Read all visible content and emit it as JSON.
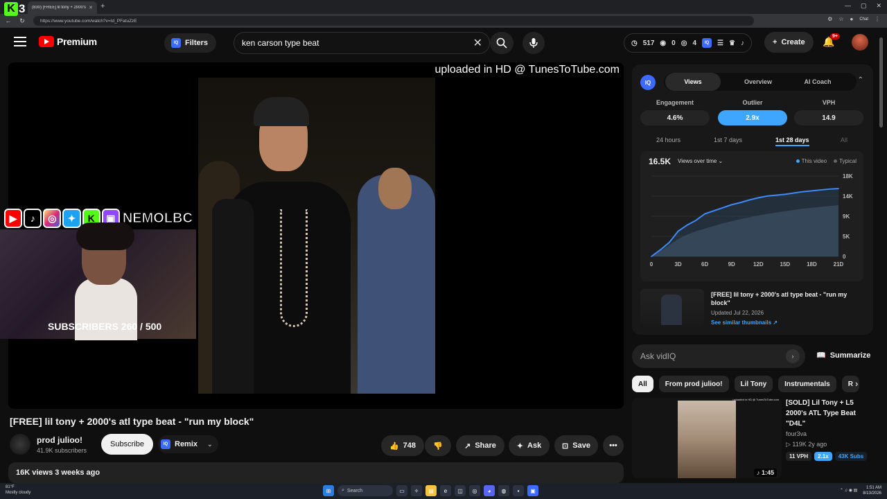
{
  "browser": {
    "tab_title": "(830) [FREE] lil tony + 2000's ...",
    "url": "https://www.youtube.com/watch?v=Id_PFatuZzE",
    "chat_label": "Chat",
    "kick_number": "3"
  },
  "header": {
    "brand": "Premium",
    "filters_label": "Filters",
    "search_value": "ken carson type beat",
    "stats": {
      "a": "517",
      "b": "0",
      "c": "4"
    },
    "create_label": "Create",
    "notif_badge": "9+"
  },
  "player": {
    "overlay_text": "uploaded in HD @ TunesToTube.com",
    "stream_handle": "NEMOLBC",
    "subscribers_goal": "SUBSCRIBERS 260 / 500"
  },
  "video": {
    "title": "[FREE] lil tony + 2000's atl type beat - \"run my block\"",
    "channel": "prod julioo!",
    "channel_subs": "41.9K subscribers",
    "subscribe_label": "Subscribe",
    "remix_label": "Remix",
    "likes": "748",
    "share_label": "Share",
    "ask_label": "Ask",
    "save_label": "Save",
    "views_line": "16K views  3 weeks ago"
  },
  "vidiq": {
    "tabs": [
      "Views",
      "Overview",
      "AI Coach"
    ],
    "metrics": [
      {
        "label": "Engagement",
        "value": "4.6%"
      },
      {
        "label": "Outlier",
        "value": "2.9x"
      },
      {
        "label": "VPH",
        "value": "14.9"
      }
    ],
    "ranges": [
      "24 hours",
      "1st 7 days",
      "1st 28 days",
      "All"
    ],
    "total_views": "16.5K",
    "chart_select": "Views over time",
    "legend": [
      "This video",
      "Typical"
    ],
    "accent": "#3ea6ff",
    "similar": {
      "title": "[FREE] lil tony + 2000's atl type beat - \"run my block\"",
      "updated": "Updated Jul 22, 2026",
      "link": "See similar thumbnails"
    }
  },
  "chart_data": {
    "type": "area",
    "x": [
      0,
      1,
      2,
      3,
      4,
      5,
      6,
      7,
      8,
      9,
      10,
      11,
      12,
      13,
      14,
      15,
      16,
      17,
      18,
      19,
      20,
      21
    ],
    "x_ticks": [
      "0",
      "3D",
      "6D",
      "9D",
      "12D",
      "15D",
      "18D",
      "21D"
    ],
    "y_ticks": [
      "0",
      "5K",
      "9K",
      "14K",
      "18K"
    ],
    "ylim": [
      0,
      18500
    ],
    "series": [
      {
        "name": "This video",
        "values": [
          0,
          1500,
          3200,
          5800,
          7200,
          8300,
          9800,
          10500,
          11200,
          11900,
          12400,
          13000,
          13500,
          13900,
          14100,
          14300,
          14600,
          14900,
          15100,
          15300,
          15500,
          15600
        ]
      },
      {
        "name": "Typical",
        "values": [
          0,
          1200,
          2600,
          4000,
          5000,
          5800,
          6400,
          7000,
          7600,
          8100,
          8600,
          9000,
          9400,
          9800,
          10100,
          10400,
          10700,
          11000,
          11200,
          11400,
          11600,
          11800
        ]
      }
    ]
  },
  "ask": {
    "placeholder": "Ask vidIQ",
    "summarize": "Summarize"
  },
  "chips": [
    "All",
    "From prod julioo!",
    "Lil Tony",
    "Instrumentals",
    "R"
  ],
  "recommendation": {
    "title": "[SOLD] Lil Tony + L5 2000's ATL Type Beat \"D4L\"",
    "channel": "four3va",
    "meta": "119K  2y ago",
    "duration": "1:45",
    "thumb_caption": "uploaded in HD @ TunesToTube.com",
    "tags": [
      "11 VPH",
      "2.1x",
      "43K Subs"
    ]
  },
  "taskbar": {
    "weather_temp": "81°F",
    "weather_desc": "Mostly cloudy",
    "search_label": "Search",
    "time": "1:51 AM",
    "date": "8/13/2026"
  }
}
